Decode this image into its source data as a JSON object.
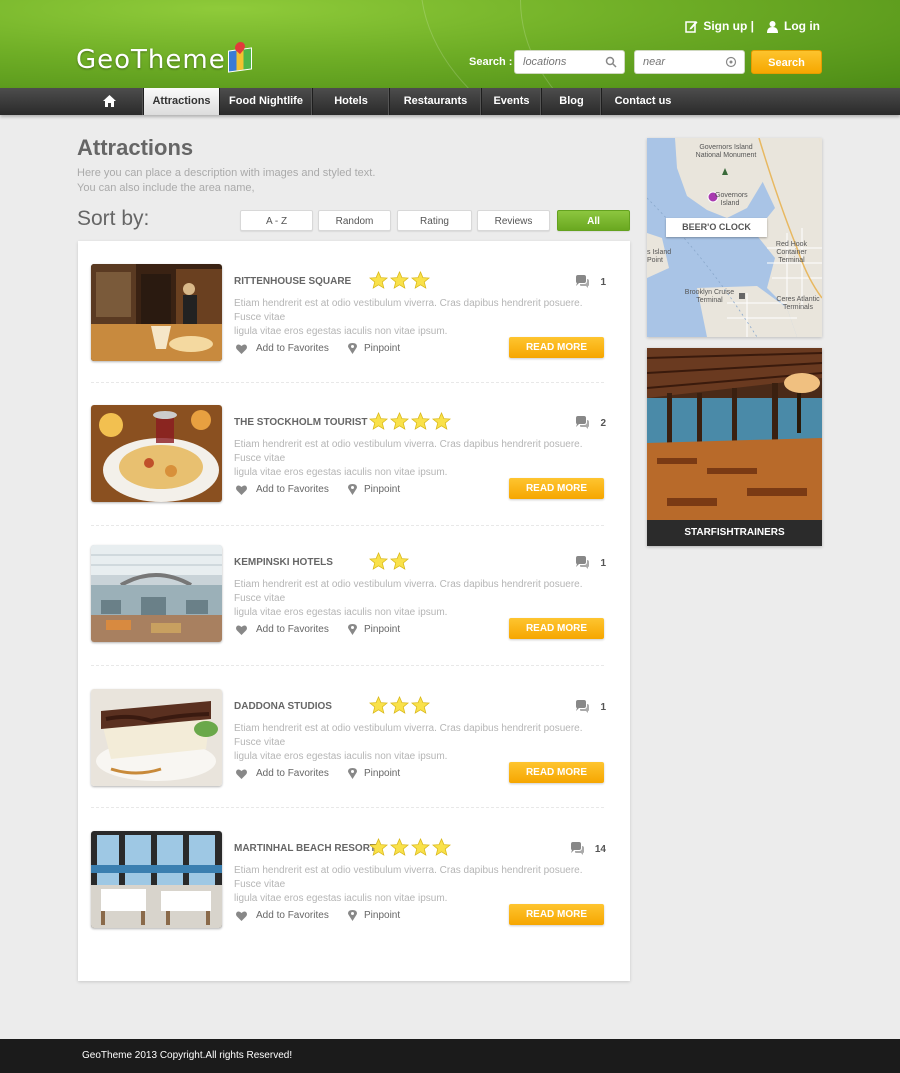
{
  "header": {
    "logo_text": "GeoTheme",
    "signup_label": "Sign up |",
    "login_label": "Log in",
    "search_label": "Search :",
    "location_placeholder": "locations",
    "near_placeholder": "near",
    "search_button": "Search"
  },
  "nav": {
    "home_icon": "home-icon",
    "items": [
      {
        "label": "Attractions",
        "active": true
      },
      {
        "label": "Food Nightlife"
      },
      {
        "label": "Hotels"
      },
      {
        "label": "Restaurants"
      },
      {
        "label": "Events"
      },
      {
        "label": "Blog"
      },
      {
        "label": "Contact us"
      }
    ]
  },
  "main": {
    "title": "Attractions",
    "description_line1": "Here you can place a description with images and styled text.",
    "description_line2": "You can also include the area name,",
    "sort_label": "Sort by:",
    "sort_options": [
      "A - Z",
      "Random",
      "Rating",
      "Reviews",
      "All"
    ],
    "active_sort": "All"
  },
  "listings": [
    {
      "title": "RITTENHOUSE SQUARE",
      "rating": 3,
      "comments": "1",
      "desc1": "Etiam hendrerit est at odio vestibulum viverra. Cras dapibus hendrerit posuere. Fusce vitae",
      "desc2": "ligula vitae eros egestas iaculis non vitae ipsum.",
      "fav": "Add to Favorites",
      "pin": "Pinpoint",
      "cta": "READ MORE"
    },
    {
      "title": "THE STOCKHOLM TOURIST",
      "rating": 4,
      "comments": "2",
      "desc1": "Etiam hendrerit est at odio vestibulum viverra. Cras dapibus hendrerit posuere. Fusce vitae",
      "desc2": "ligula vitae eros egestas iaculis non vitae ipsum.",
      "fav": "Add to Favorites",
      "pin": "Pinpoint",
      "cta": "READ MORE"
    },
    {
      "title": "KEMPINSKI HOTELS",
      "rating": 2,
      "comments": "1",
      "desc1": "Etiam hendrerit est at odio vestibulum viverra. Cras dapibus hendrerit posuere. Fusce vitae",
      "desc2": "ligula vitae eros egestas iaculis non vitae ipsum.",
      "fav": "Add to Favorites",
      "pin": "Pinpoint",
      "cta": "READ MORE"
    },
    {
      "title": "DADDONA STUDIOS",
      "rating": 3,
      "comments": "1",
      "desc1": "Etiam hendrerit est at odio vestibulum viverra. Cras dapibus hendrerit posuere. Fusce vitae",
      "desc2": "ligula vitae eros egestas iaculis non vitae ipsum.",
      "fav": "Add to Favorites",
      "pin": "Pinpoint",
      "cta": "READ MORE"
    },
    {
      "title": "MARTINHAL BEACH RESORT",
      "rating": 4,
      "comments": "14",
      "desc1": "Etiam hendrerit est at odio vestibulum viverra. Cras dapibus hendrerit posuere. Fusce vitae",
      "desc2": "ligula vitae eros egestas iaculis non vitae ipsum.",
      "fav": "Add to Favorites",
      "pin": "Pinpoint",
      "cta": "READ MORE"
    }
  ],
  "sidebar": {
    "map_tag": "BEER'O CLOCK",
    "map_labels": {
      "governors": "Governors Island National Monument",
      "governors_island": "Governors Island",
      "red_hook": "Red Hook Container Terminal",
      "brooklyn": "Brooklyn Cruise Terminal",
      "ceres": "Ceres Atlantic Terminals",
      "island_point": "s Island Point"
    },
    "feature_caption": "STARFISHTRAINERS"
  },
  "footer": {
    "copyright": "GeoTheme 2013 Copyright.All rights Reserved!"
  },
  "colors": {
    "brand_green": "#6fae26",
    "accent_orange": "#f6a700",
    "nav_dark": "#2a2a2a"
  }
}
